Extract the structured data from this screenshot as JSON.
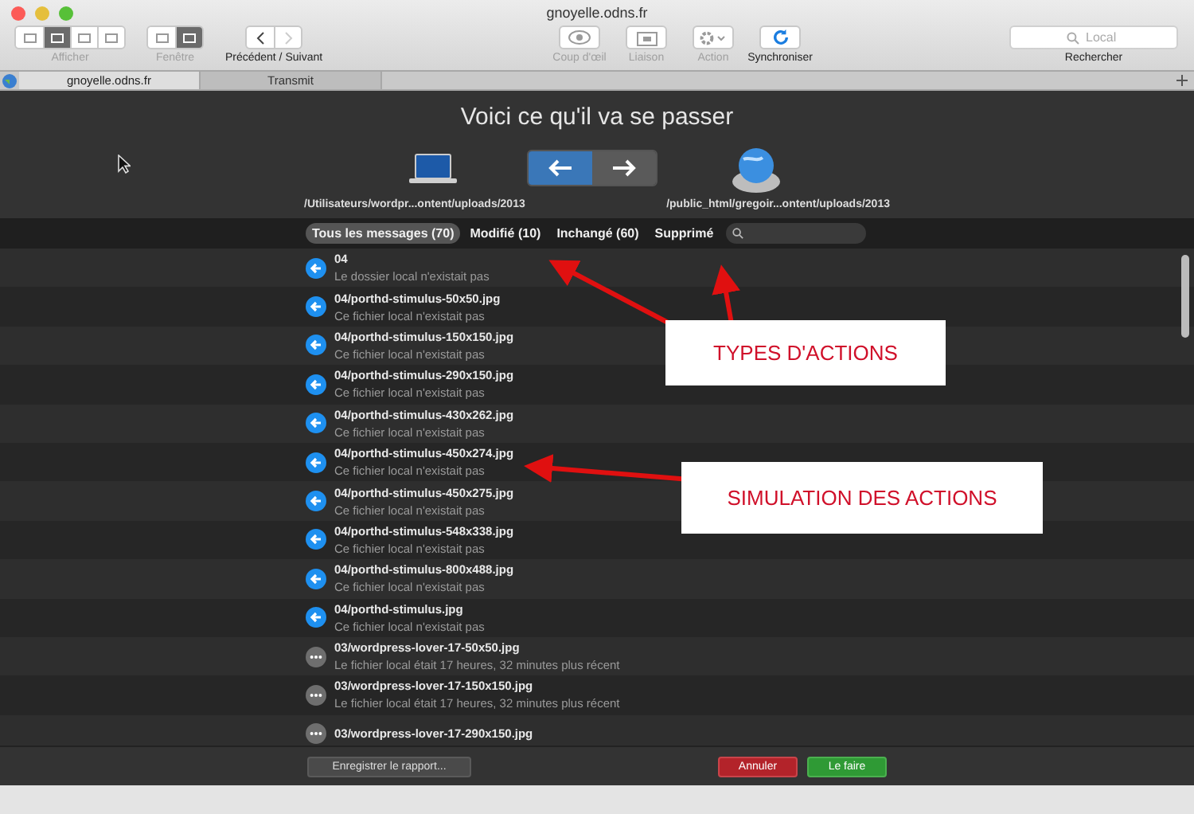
{
  "window": {
    "title": "gnoyelle.odns.fr"
  },
  "toolbar": {
    "view": {
      "label": "Afficher",
      "segments": [
        {
          "selected": false
        },
        {
          "selected": true
        },
        {
          "selected": false
        },
        {
          "selected": false
        }
      ]
    },
    "window_mode": {
      "label": "Fenêtre",
      "segments": [
        {
          "selected": false
        },
        {
          "selected": true
        }
      ]
    },
    "navigation": {
      "label": "Précédent / Suivant",
      "back_disabled": false,
      "forward_disabled": true
    },
    "actions": [
      {
        "kind": "eye",
        "label": "Coup d'œil",
        "disabled": true
      },
      {
        "kind": "link",
        "label": "Liaison",
        "disabled": true
      },
      {
        "kind": "gear",
        "label": "Action",
        "disabled": true
      },
      {
        "kind": "sync",
        "label": "Synchroniser",
        "disabled": false
      }
    ],
    "search": {
      "placeholder": "Local",
      "label": "Rechercher"
    }
  },
  "tabs": [
    {
      "label": "gnoyelle.odns.fr",
      "selected": true
    },
    {
      "label": "Transmit",
      "selected": false
    }
  ],
  "sheet": {
    "heading": "Voici ce qu'il va se passer",
    "direction": [
      {
        "kind": "left",
        "selected": true
      },
      {
        "kind": "right",
        "selected": false
      }
    ],
    "local_path": "/Utilisateurs/wordpr...ontent/uploads/2013",
    "remote_path": "/public_html/gregoir...ontent/uploads/2013",
    "filters": [
      {
        "label": "Tous les messages (70)",
        "selected": true
      },
      {
        "label": "Modifié (10)",
        "selected": false
      },
      {
        "label": "Inchangé (60)",
        "selected": false
      },
      {
        "label": "Supprimé",
        "selected": false
      }
    ],
    "rows": [
      {
        "kind": "download",
        "name": "04",
        "detail": "Le dossier local n'existait pas"
      },
      {
        "kind": "download",
        "name": "04/porthd-stimulus-50x50.jpg",
        "detail": "Ce fichier local n'existait pas"
      },
      {
        "kind": "download",
        "name": "04/porthd-stimulus-150x150.jpg",
        "detail": "Ce fichier local n'existait pas"
      },
      {
        "kind": "download",
        "name": "04/porthd-stimulus-290x150.jpg",
        "detail": "Ce fichier local n'existait pas"
      },
      {
        "kind": "download",
        "name": "04/porthd-stimulus-430x262.jpg",
        "detail": "Ce fichier local n'existait pas"
      },
      {
        "kind": "download",
        "name": "04/porthd-stimulus-450x274.jpg",
        "detail": "Ce fichier local n'existait pas"
      },
      {
        "kind": "download",
        "name": "04/porthd-stimulus-450x275.jpg",
        "detail": "Ce fichier local n'existait pas"
      },
      {
        "kind": "download",
        "name": "04/porthd-stimulus-548x338.jpg",
        "detail": "Ce fichier local n'existait pas"
      },
      {
        "kind": "download",
        "name": "04/porthd-stimulus-800x488.jpg",
        "detail": "Ce fichier local n'existait pas"
      },
      {
        "kind": "download",
        "name": "04/porthd-stimulus.jpg",
        "detail": "Ce fichier local n'existait pas"
      },
      {
        "kind": "newer",
        "name": "03/wordpress-lover-17-50x50.jpg",
        "detail": "Le fichier local était 17 heures, 32 minutes plus récent"
      },
      {
        "kind": "newer",
        "name": "03/wordpress-lover-17-150x150.jpg",
        "detail": "Le fichier local était 17 heures, 32 minutes plus récent"
      },
      {
        "kind": "newer",
        "name": "03/wordpress-lover-17-290x150.jpg"
      }
    ],
    "buttons": [
      {
        "kind": "plain",
        "label": "Enregistrer le rapport..."
      },
      {
        "kind": "cancel",
        "label": "Annuler"
      },
      {
        "kind": "confirm",
        "label": "Le faire"
      }
    ]
  },
  "annotations": [
    {
      "text": "TYPES D'ACTIONS"
    },
    {
      "text": "SIMULATION DES ACTIONS"
    }
  ]
}
